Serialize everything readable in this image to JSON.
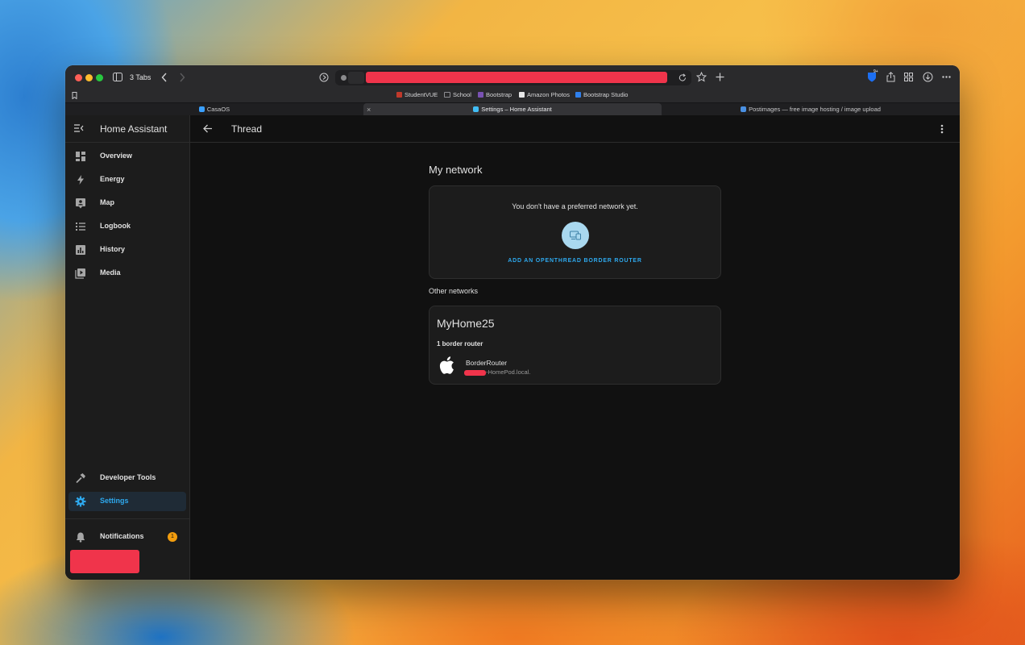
{
  "browser": {
    "tabs_count_label": "3 Tabs",
    "bookmarks": [
      {
        "label": "StudentVUE",
        "color": "#c0392b"
      },
      {
        "label": "School",
        "color": "#8e8e93"
      },
      {
        "label": "Bootstrap",
        "color": "#7952b3"
      },
      {
        "label": "Amazon Photos",
        "color": "#e6e6e6"
      },
      {
        "label": "Bootstrap Studio",
        "color": "#2f80ed"
      }
    ],
    "tabs": [
      {
        "label": "CasaOS",
        "active": false,
        "color": "#3aa0ff"
      },
      {
        "label": "Settings – Home Assistant",
        "active": true,
        "color": "#41bdf5"
      },
      {
        "label": "Postimages — free image hosting / image upload",
        "active": false,
        "color": "#4a90e2"
      }
    ],
    "extension_badge": "9+"
  },
  "sidebar": {
    "title": "Home Assistant",
    "items": [
      {
        "label": "Overview",
        "icon": "dashboard-icon"
      },
      {
        "label": "Energy",
        "icon": "lightning-icon"
      },
      {
        "label": "Map",
        "icon": "map-icon"
      },
      {
        "label": "Logbook",
        "icon": "list-icon"
      },
      {
        "label": "History",
        "icon": "chart-icon"
      },
      {
        "label": "Media",
        "icon": "media-icon"
      }
    ],
    "bottom_items": [
      {
        "label": "Developer Tools",
        "icon": "hammer-icon"
      },
      {
        "label": "Settings",
        "icon": "gear-icon",
        "active": true
      }
    ],
    "notifications": {
      "label": "Notifications",
      "count": "1"
    }
  },
  "header": {
    "title": "Thread"
  },
  "main": {
    "my_network_title": "My network",
    "preferred_text": "You don't have a preferred network yet.",
    "add_router_link": "ADD AN OPENTHREAD BORDER ROUTER",
    "other_networks_title": "Other networks",
    "network": {
      "name": "MyHome25",
      "router_count": "1 border router",
      "router_name": "BorderRouter",
      "router_host": "-HomePod.local."
    }
  },
  "colors": {
    "accent": "#2ea9ee",
    "redaction": "#f0344b",
    "badge": "#f29d0e"
  }
}
